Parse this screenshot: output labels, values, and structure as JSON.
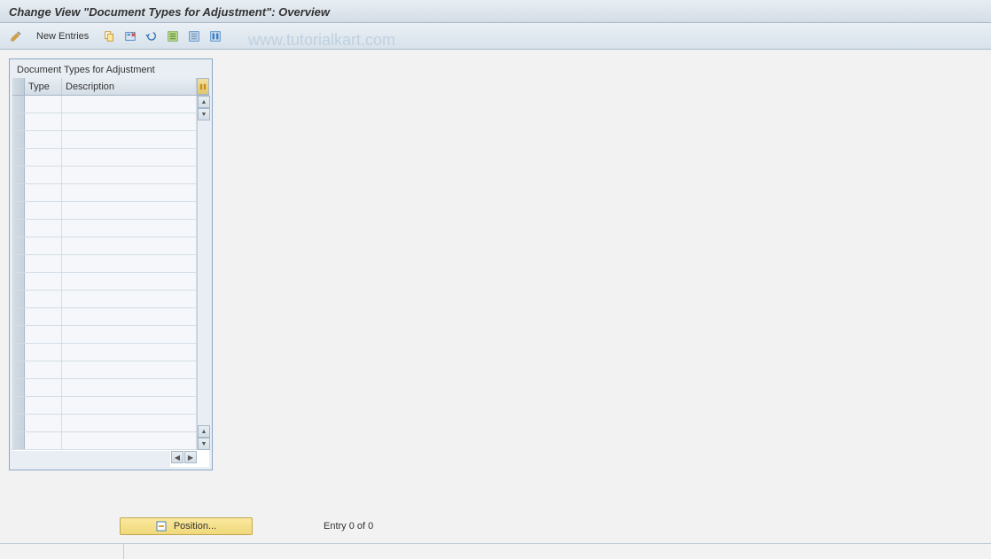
{
  "title": "Change View \"Document Types for Adjustment\": Overview",
  "watermark": "www.tutorialkart.com",
  "toolbar": {
    "new_entries_label": "New Entries"
  },
  "table": {
    "title": "Document Types for Adjustment",
    "columns": {
      "type": "Type",
      "description": "Description"
    },
    "rows": [
      {
        "type": "",
        "description": ""
      },
      {
        "type": "",
        "description": ""
      },
      {
        "type": "",
        "description": ""
      },
      {
        "type": "",
        "description": ""
      },
      {
        "type": "",
        "description": ""
      },
      {
        "type": "",
        "description": ""
      },
      {
        "type": "",
        "description": ""
      },
      {
        "type": "",
        "description": ""
      },
      {
        "type": "",
        "description": ""
      },
      {
        "type": "",
        "description": ""
      },
      {
        "type": "",
        "description": ""
      },
      {
        "type": "",
        "description": ""
      },
      {
        "type": "",
        "description": ""
      },
      {
        "type": "",
        "description": ""
      },
      {
        "type": "",
        "description": ""
      },
      {
        "type": "",
        "description": ""
      },
      {
        "type": "",
        "description": ""
      },
      {
        "type": "",
        "description": ""
      },
      {
        "type": "",
        "description": ""
      },
      {
        "type": "",
        "description": ""
      }
    ]
  },
  "footer": {
    "position_label": "Position...",
    "entry_status": "Entry 0 of 0"
  }
}
